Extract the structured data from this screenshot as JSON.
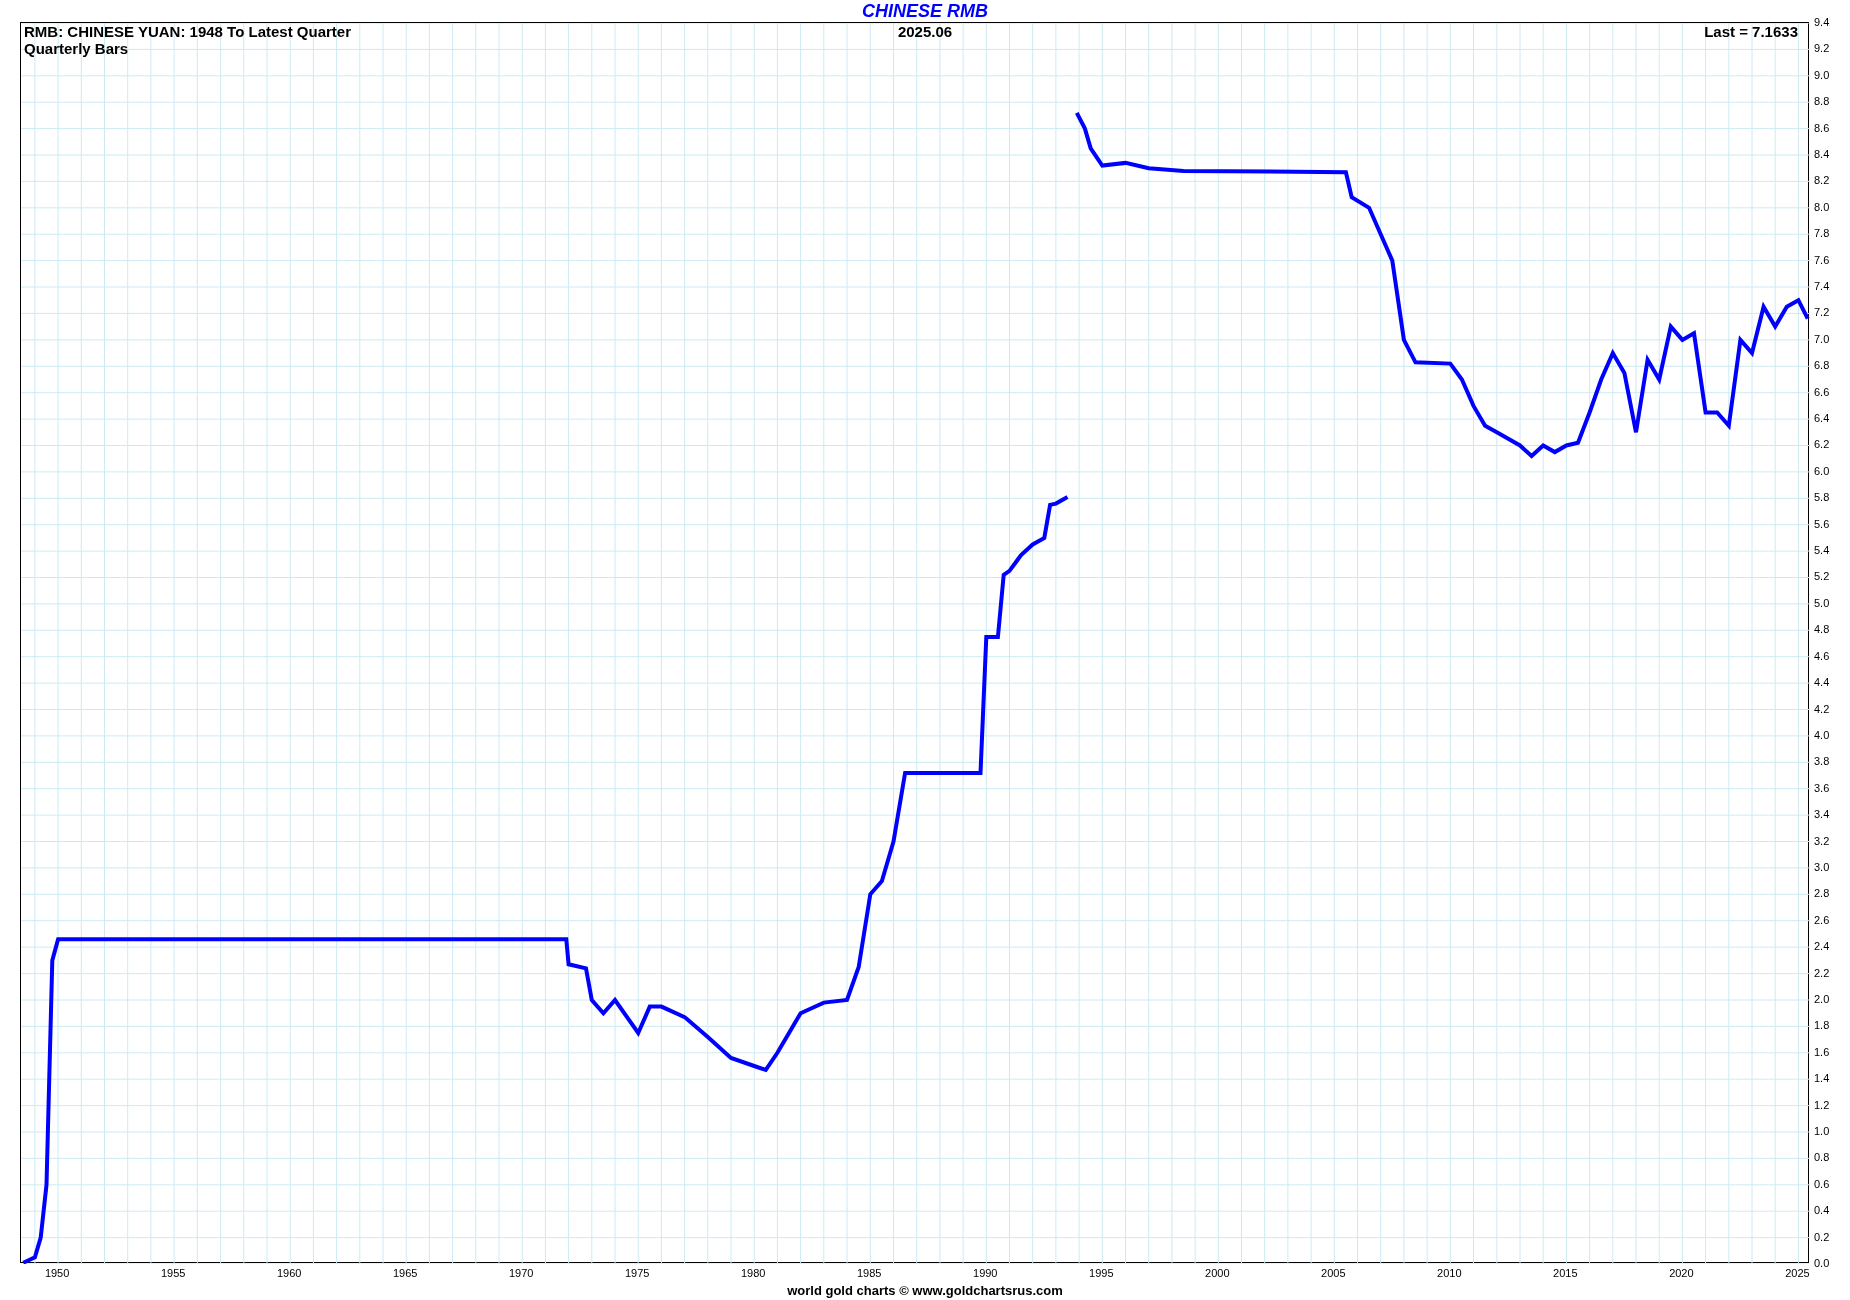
{
  "header": {
    "left": "RMB: CHINESE YUAN: 1948 To Latest Quarter",
    "left_sub": "Quarterly Bars",
    "center": "2025.06",
    "right": "Last = 7.1633"
  },
  "chart_data": {
    "type": "line",
    "title": "CHINESE RMB",
    "grid": true,
    "xlim": [
      1948.4,
      2025.5
    ],
    "ylim": [
      0,
      9.4
    ],
    "xticks": [
      1950,
      1955,
      1960,
      1965,
      1970,
      1975,
      1980,
      1985,
      1990,
      1995,
      2000,
      2005,
      2010,
      2015,
      2020,
      2025
    ],
    "yticks": [
      {
        "value": 0,
        "label": "0.0"
      },
      {
        "value": 0.2,
        "label": "0.2"
      },
      {
        "value": 0.4,
        "label": "0.4"
      },
      {
        "value": 0.6,
        "label": "0.6"
      },
      {
        "value": 0.8,
        "label": "0.8"
      },
      {
        "value": 1,
        "label": "1.0"
      },
      {
        "value": 1.2,
        "label": "1.2"
      },
      {
        "value": 1.4,
        "label": "1.4"
      },
      {
        "value": 1.6,
        "label": "1.6"
      },
      {
        "value": 1.8,
        "label": "1.8"
      },
      {
        "value": 2,
        "label": "2.0"
      },
      {
        "value": 2.2,
        "label": "2.2"
      },
      {
        "value": 2.4,
        "label": "2.4"
      },
      {
        "value": 2.6,
        "label": "2.6"
      },
      {
        "value": 2.8,
        "label": "2.8"
      },
      {
        "value": 3,
        "label": "3.0"
      },
      {
        "value": 3.2,
        "label": "3.2"
      },
      {
        "value": 3.4,
        "label": "3.4"
      },
      {
        "value": 3.6,
        "label": "3.6"
      },
      {
        "value": 3.8,
        "label": "3.8"
      },
      {
        "value": 4,
        "label": "4.0"
      },
      {
        "value": 4.2,
        "label": "4.2"
      },
      {
        "value": 4.4,
        "label": "4.4"
      },
      {
        "value": 4.6,
        "label": "4.6"
      },
      {
        "value": 4.8,
        "label": "4.8"
      },
      {
        "value": 5,
        "label": "5.0"
      },
      {
        "value": 5.2,
        "label": "5.2"
      },
      {
        "value": 5.4,
        "label": "5.4"
      },
      {
        "value": 5.6,
        "label": "5.6"
      },
      {
        "value": 5.8,
        "label": "5.8"
      },
      {
        "value": 6,
        "label": "6.0"
      },
      {
        "value": 6.2,
        "label": "6.2"
      },
      {
        "value": 6.4,
        "label": "6.4"
      },
      {
        "value": 6.6,
        "label": "6.6"
      },
      {
        "value": 6.8,
        "label": "6.8"
      },
      {
        "value": 7,
        "label": "7.0"
      },
      {
        "value": 7.2,
        "label": "7.2"
      },
      {
        "value": 7.4,
        "label": "7.4"
      },
      {
        "value": 7.6,
        "label": "7.6"
      },
      {
        "value": 7.8,
        "label": "7.8"
      },
      {
        "value": 8,
        "label": "8.0"
      },
      {
        "value": 8.2,
        "label": "8.2"
      },
      {
        "value": 8.4,
        "label": "8.4"
      },
      {
        "value": 8.6,
        "label": "8.6"
      },
      {
        "value": 8.8,
        "label": "8.8"
      },
      {
        "value": 9,
        "label": "9.0"
      },
      {
        "value": 9.2,
        "label": "9.2"
      },
      {
        "value": 9.4,
        "label": "9.4"
      }
    ],
    "x": [
      1948.5,
      1949,
      1949.25,
      1949.5,
      1949.75,
      1950,
      1971.9,
      1972,
      1972.75,
      1973,
      1973.5,
      1974,
      1975,
      1975.5,
      1976,
      1977,
      1978,
      1979,
      1980,
      1980.5,
      1981,
      1981.5,
      1982,
      1983,
      1984,
      1984.5,
      1985,
      1985.5,
      1986,
      1986.5,
      1989.75,
      1990,
      1990.5,
      1990.75,
      1991,
      1991.5,
      1992,
      1992.5,
      1992.75,
      1993,
      1993.5,
      1993.7,
      1993.9,
      1994.25,
      1994.5,
      1995,
      1996,
      1997,
      1998.5,
      2005.5,
      2005.75,
      2006.5,
      2007,
      2007.5,
      2008,
      2008.5,
      2010,
      2010.5,
      2011,
      2011.5,
      2012,
      2013,
      2013.5,
      2014,
      2014.5,
      2015,
      2015.5,
      2016,
      2016.5,
      2017,
      2017.5,
      2018,
      2018.5,
      2019,
      2019.5,
      2020,
      2020.5,
      2021,
      2021.5,
      2022,
      2022.5,
      2023,
      2023.5,
      2024,
      2024.5,
      2025,
      2025.4
    ],
    "series": [
      {
        "color": "#0000ff",
        "values": [
          0.01,
          0.05,
          0.2,
          0.6,
          2.3,
          2.46,
          2.46,
          2.27,
          2.24,
          2.0,
          1.9,
          2.0,
          1.75,
          1.95,
          1.95,
          1.87,
          1.72,
          1.56,
          1.5,
          1.47,
          1.6,
          1.75,
          1.9,
          1.98,
          2.0,
          2.25,
          2.8,
          2.9,
          3.2,
          3.72,
          3.72,
          4.75,
          4.75,
          5.22,
          5.25,
          5.37,
          5.45,
          5.5,
          5.75,
          5.76,
          5.81,
          null,
          8.72,
          8.6,
          8.45,
          8.32,
          8.34,
          8.3,
          8.28,
          8.27,
          8.08,
          8.0,
          7.8,
          7.6,
          7.0,
          6.83,
          6.82,
          6.7,
          6.5,
          6.35,
          6.3,
          6.2,
          6.12,
          6.2,
          6.15,
          6.2,
          6.22,
          6.45,
          6.7,
          6.9,
          6.75,
          6.3,
          6.85,
          6.7,
          7.1,
          7.0,
          7.05,
          6.45,
          6.45,
          6.35,
          7.0,
          6.9,
          7.25,
          7.1,
          7.25,
          7.3,
          7.16
        ]
      }
    ]
  },
  "footer": "world gold charts © www.goldchartsrus.com"
}
